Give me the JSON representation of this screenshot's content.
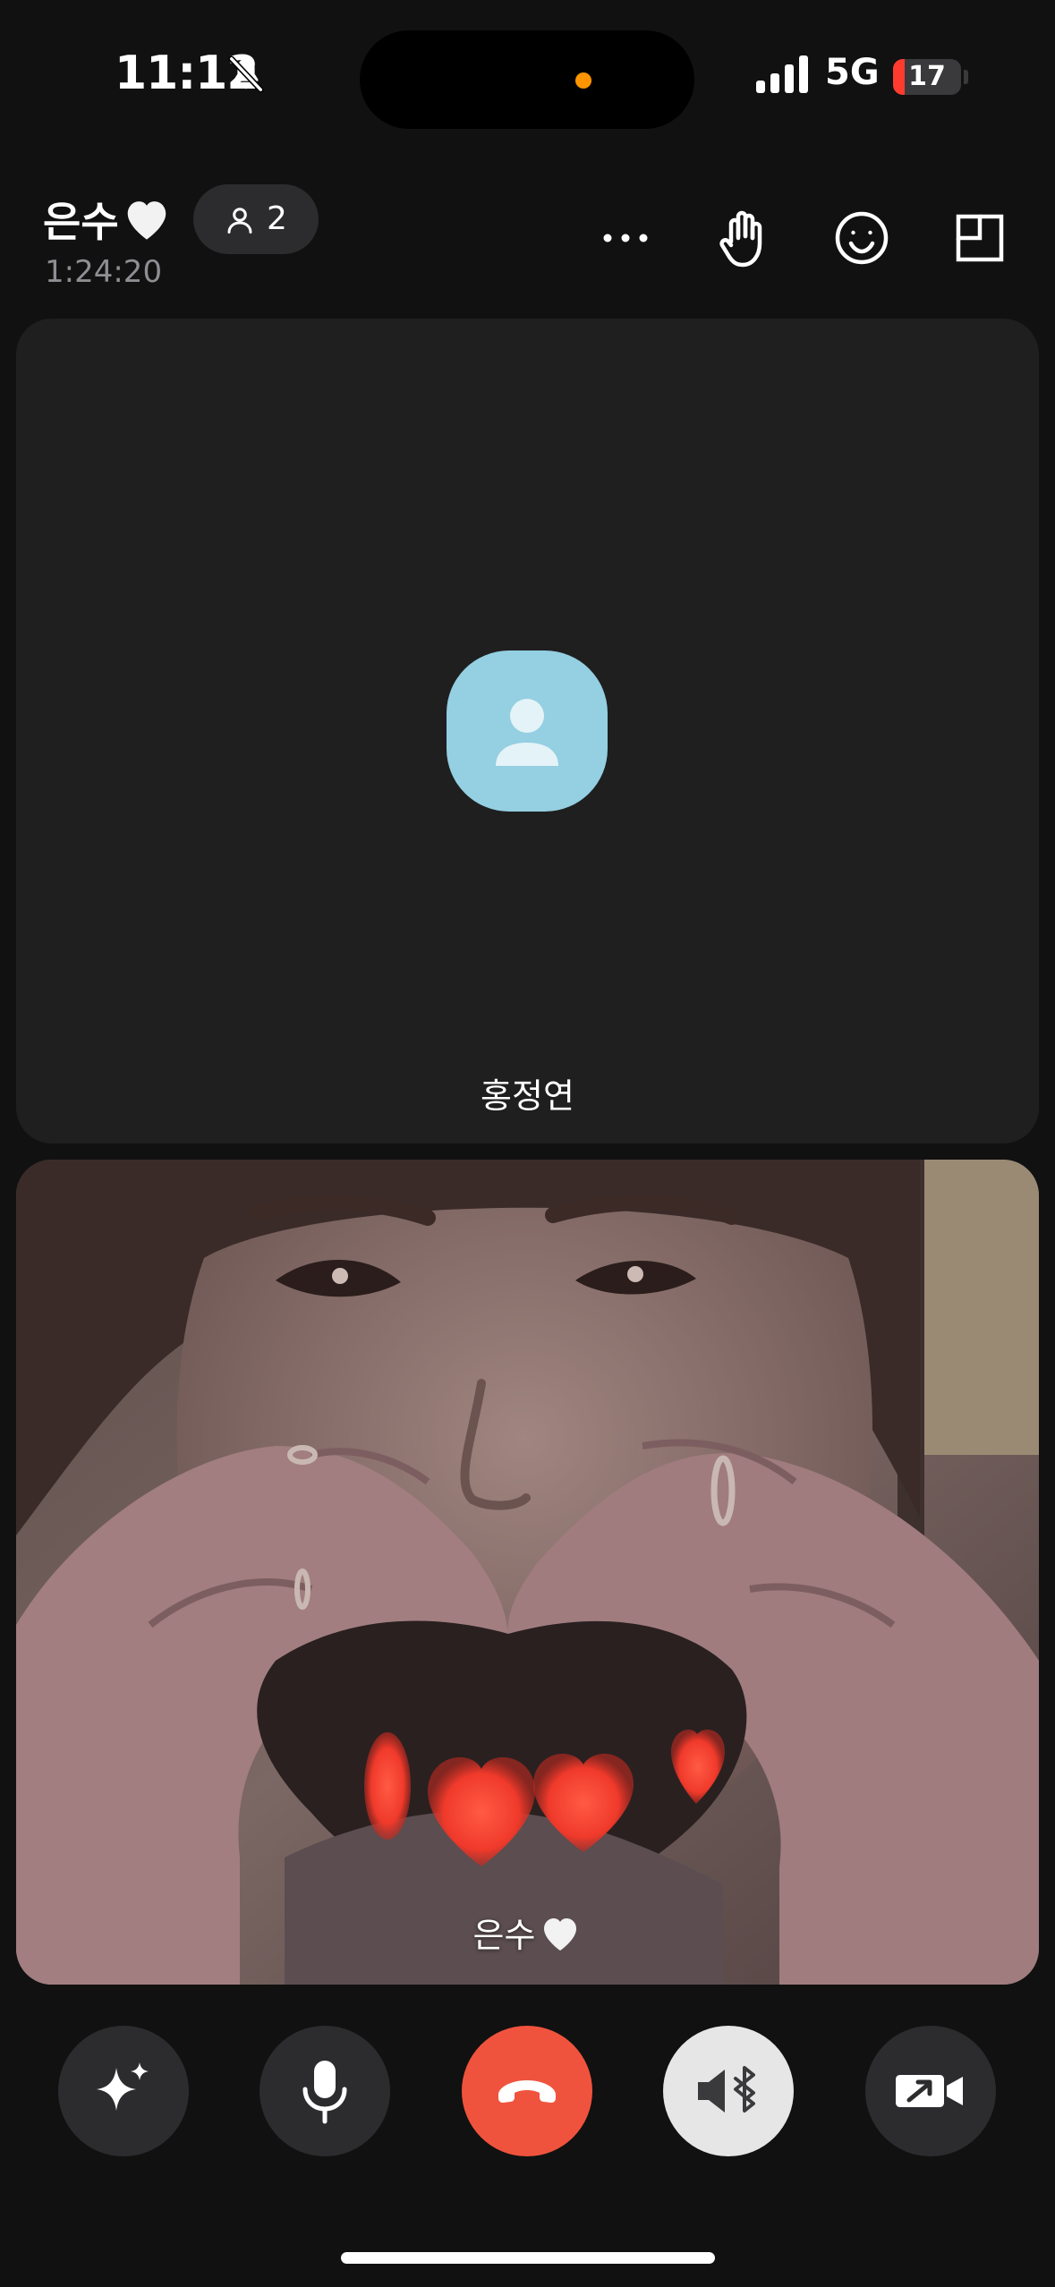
{
  "status_bar": {
    "time": "11:12",
    "network": "5G",
    "battery_level": "17",
    "battery_fraction": 0.17,
    "icons": [
      "bell-slash-icon",
      "cellular-signal-icon",
      "battery-icon"
    ],
    "colors": {
      "battery_low": "#ff3b30",
      "privacy_dot": "#ff9500"
    }
  },
  "call": {
    "title": "은수",
    "duration": "1:24:20",
    "participants": "2",
    "header_icons": [
      "more-icon",
      "raise-hand-icon",
      "emoji-icon",
      "layout-icon"
    ]
  },
  "tiles": [
    {
      "label": "홍정연",
      "video": "off",
      "avatar_color": "#94cfe2"
    },
    {
      "label": "은수",
      "video": "on"
    }
  ],
  "controls": {
    "icons": [
      "effects-sparkle-icon",
      "microphone-icon",
      "end-call-icon",
      "bluetooth-speaker-icon",
      "camera-switch-icon"
    ],
    "colors": {
      "end_call": "#f0533d",
      "speaker_active": "#e6e6e6",
      "default": "#2c2c2e"
    }
  }
}
